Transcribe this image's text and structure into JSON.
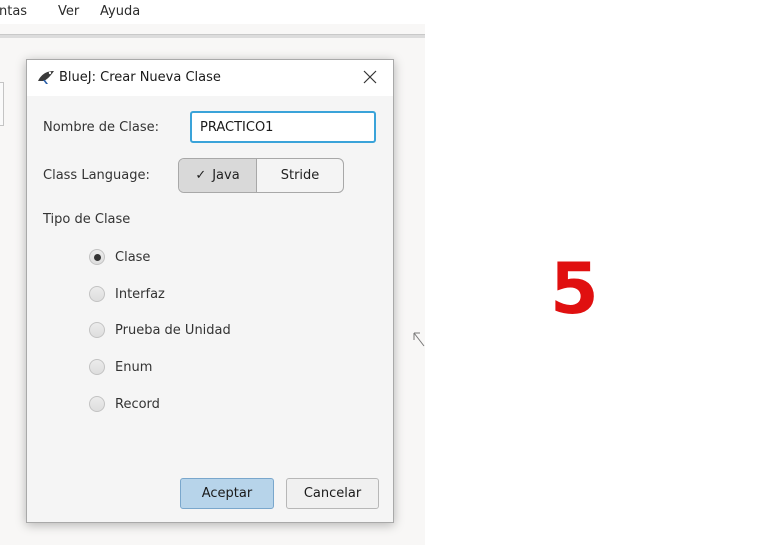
{
  "menubar": {
    "items": [
      {
        "label": "ntas"
      },
      {
        "label": "Ver"
      },
      {
        "label": "Ayuda"
      }
    ]
  },
  "dialog": {
    "title": "BlueJ:  Crear Nueva Clase",
    "name_label": "Nombre de Clase:",
    "name_value": "PRACTICO1",
    "language_label": "Class Language:",
    "language_options": [
      "Java",
      "Stride"
    ],
    "language_selected": "Java",
    "type_label": "Tipo de Clase",
    "types": [
      {
        "label": "Clase",
        "selected": true
      },
      {
        "label": "Interfaz",
        "selected": false
      },
      {
        "label": "Prueba de Unidad",
        "selected": false
      },
      {
        "label": "Enum",
        "selected": false
      },
      {
        "label": "Record",
        "selected": false
      }
    ],
    "ok_label": "Aceptar",
    "cancel_label": "Cancelar"
  },
  "step_number": "5",
  "colors": {
    "accent_focus": "#3aa3d9",
    "ok_button": "#b7d4ea",
    "step_number": "#e01010"
  },
  "icons": [
    "bluej-bird-icon",
    "close-icon",
    "checkmark-icon",
    "mouse-cursor-icon"
  ]
}
